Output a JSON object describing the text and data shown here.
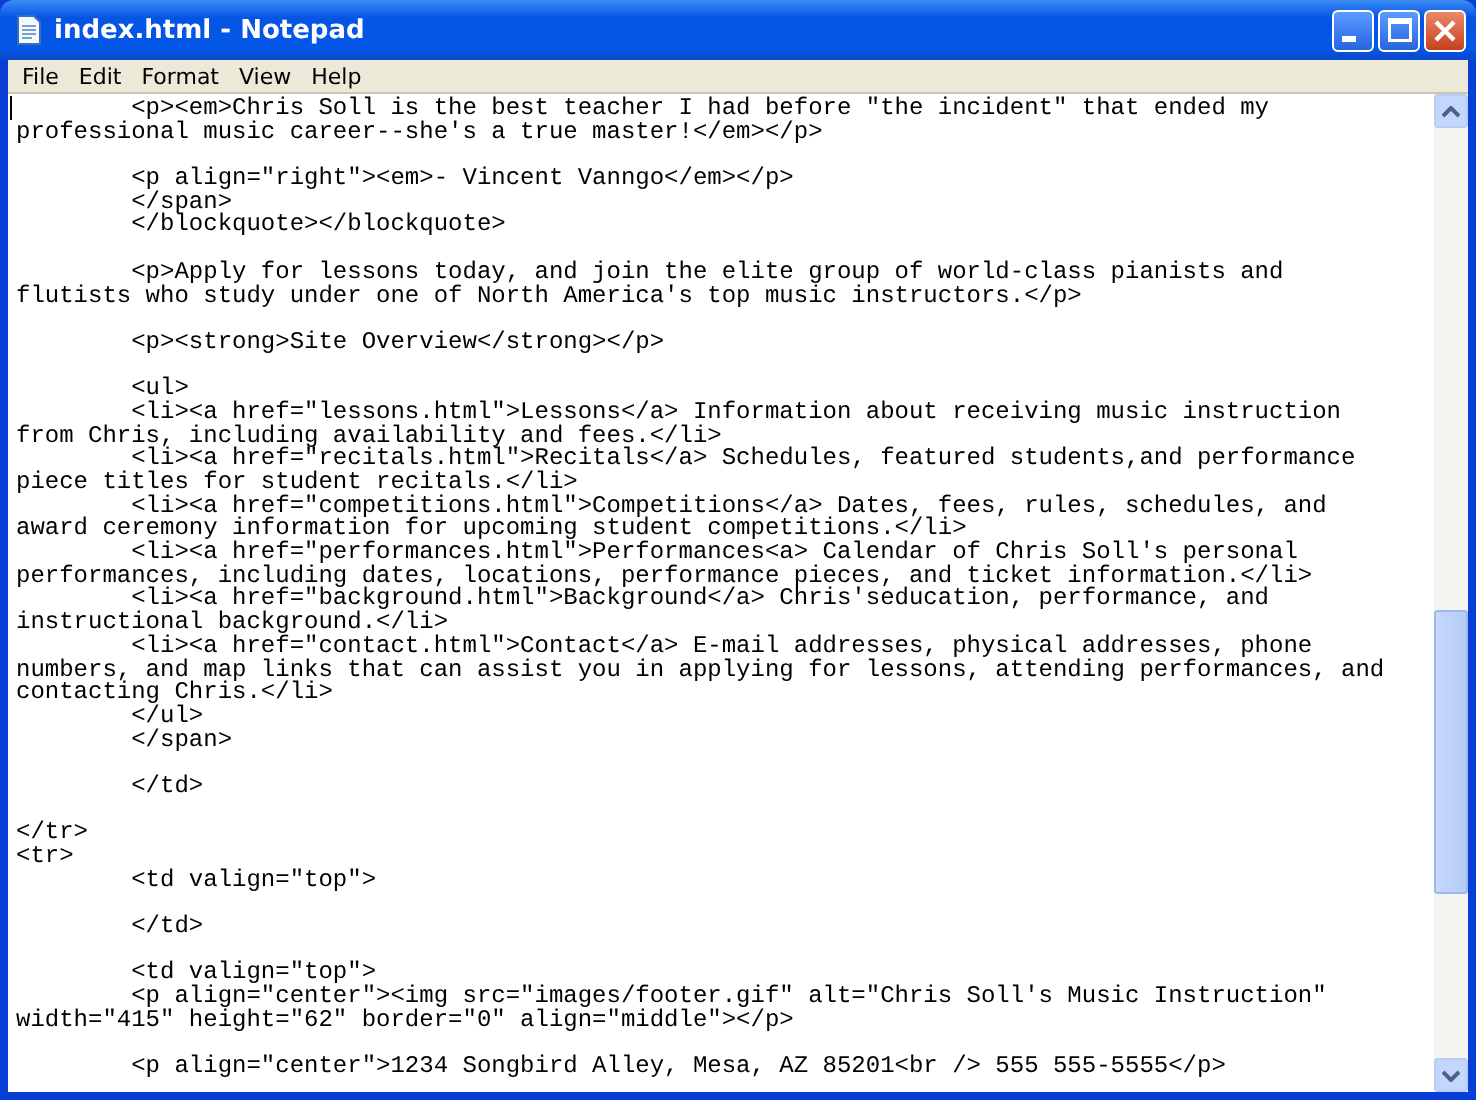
{
  "window": {
    "title": "index.html - Notepad"
  },
  "menu": [
    "File",
    "Edit",
    "Format",
    "View",
    "Help"
  ],
  "editor": {
    "blocks": [
      [
        "\t<p><em>Chris Soll is the best teacher I had before \"the incident\" that ended my",
        "professional music career--she's a true master!</em></p>"
      ],
      [
        "\t<p align=\"right\"><em>- Vincent Vanngo</em></p>",
        "\t</span>",
        "\t</blockquote></blockquote>"
      ],
      [
        "\t<p>Apply for lessons today, and join the elite group of world-class pianists and",
        "flutists who study under one of North America's top music instructors.</p>"
      ],
      [
        "\t<p><strong>Site Overview</strong></p>"
      ],
      [
        "\t<ul>",
        "\t<li><a href=\"lessons.html\">Lessons</a> Information about receiving music instruction",
        "from Chris, including availability and fees.</li>",
        "\t<li><a href=\"recitals.html\">Recitals</a> Schedules, featured students,and performance",
        "piece titles for student recitals.</li>",
        "\t<li><a href=\"competitions.html\">Competitions</a> Dates, fees, rules, schedules, and",
        "award ceremony information for upcoming student competitions.</li>",
        "\t<li><a href=\"performances.html\">Performances<a> Calendar of Chris Soll's personal",
        "performances, including dates, locations, performance pieces, and ticket information.</li>",
        "\t<li><a href=\"background.html\">Background</a> Chris'seducation, performance, and",
        "instructional background.</li>",
        "\t<li><a href=\"contact.html\">Contact</a> E-mail addresses, physical addresses, phone",
        "numbers, and map links that can assist you in applying for lessons, attending performances, and",
        "contacting Chris.</li>",
        "\t</ul>",
        "\t</span>"
      ],
      [
        "\t</td>"
      ],
      [
        "</tr>",
        "<tr>",
        "\t<td valign=\"top\">"
      ],
      [
        "\t</td>"
      ],
      [
        "\t<td valign=\"top\">",
        "\t<p align=\"center\"><img src=\"images/footer.gif\" alt=\"Chris Soll's Music Instruction\"",
        "width=\"415\" height=\"62\" border=\"0\" align=\"middle\"></p>"
      ],
      [
        "\t<p align=\"center\">1234 Songbird Alley, Mesa, AZ 85201<br /> 555 555-5555</p>"
      ]
    ]
  }
}
